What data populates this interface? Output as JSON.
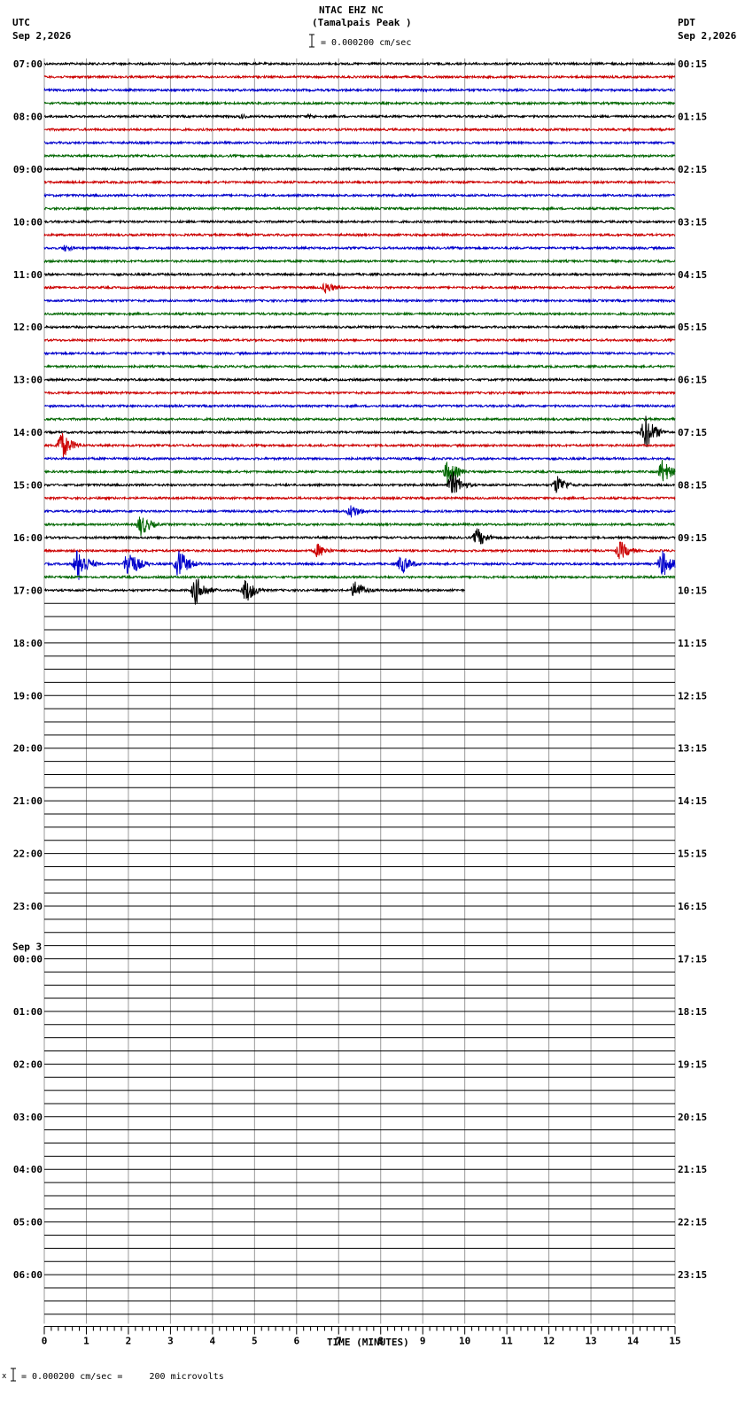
{
  "header": {
    "station": "NTAC EHZ NC",
    "site": "(Tamalpais Peak )",
    "scale_label": "= 0.000200 cm/sec",
    "left_tz": "UTC",
    "left_date": "Sep 2,2026",
    "right_tz": "PDT",
    "right_date": "Sep 2,2026"
  },
  "footer": {
    "scale_note": "= 0.000200 cm/sec =     200 microvolts",
    "corner_mark": "x"
  },
  "chart_data": {
    "type": "line",
    "title": "NTAC EHZ NC (Tamalpais Peak )",
    "xlabel": "TIME (MINUTES)",
    "xlim": [
      0,
      15
    ],
    "x_ticks": [
      "0",
      "1",
      "2",
      "3",
      "4",
      "5",
      "6",
      "7",
      "8",
      "9",
      "10",
      "11",
      "12",
      "13",
      "14",
      "15"
    ],
    "rows_per_hour": 4,
    "total_rows": 96,
    "rows_with_data": 41,
    "last_row_end_minute": 10,
    "trace_colors": [
      "#000000",
      "#cc0000",
      "#0000cc",
      "#006600"
    ],
    "utc_labels": [
      "07:00",
      "08:00",
      "09:00",
      "10:00",
      "11:00",
      "12:00",
      "13:00",
      "14:00",
      "15:00",
      "16:00",
      "17:00",
      "18:00",
      "19:00",
      "20:00",
      "21:00",
      "22:00",
      "23:00",
      "00:00",
      "01:00",
      "02:00",
      "03:00",
      "04:00",
      "05:00",
      "06:00"
    ],
    "date_change_label": "Sep 3",
    "local_labels": [
      "00:15",
      "01:15",
      "02:15",
      "03:15",
      "04:15",
      "05:15",
      "06:15",
      "07:15",
      "08:15",
      "09:15",
      "10:15",
      "11:15",
      "12:15",
      "13:15",
      "14:15",
      "15:15",
      "16:15",
      "17:15",
      "18:15",
      "19:15",
      "20:15",
      "21:15",
      "22:15",
      "23:15"
    ],
    "events": [
      {
        "row": 4,
        "minute": 4.7,
        "amp": 0.2
      },
      {
        "row": 4,
        "minute": 6.3,
        "amp": 0.2
      },
      {
        "row": 14,
        "minute": 0.5,
        "amp": 0.3
      },
      {
        "row": 17,
        "minute": 6.7,
        "amp": 0.5
      },
      {
        "row": 28,
        "minute": 14.3,
        "amp": 1.4
      },
      {
        "row": 29,
        "minute": 0.4,
        "amp": 1.2
      },
      {
        "row": 31,
        "minute": 9.6,
        "amp": 1.0
      },
      {
        "row": 31,
        "minute": 14.7,
        "amp": 1.0
      },
      {
        "row": 32,
        "minute": 9.7,
        "amp": 1.1
      },
      {
        "row": 32,
        "minute": 12.2,
        "amp": 0.8
      },
      {
        "row": 34,
        "minute": 7.3,
        "amp": 0.6
      },
      {
        "row": 35,
        "minute": 2.3,
        "amp": 0.9
      },
      {
        "row": 36,
        "minute": 10.3,
        "amp": 0.8
      },
      {
        "row": 37,
        "minute": 6.5,
        "amp": 0.6
      },
      {
        "row": 37,
        "minute": 13.7,
        "amp": 0.8
      },
      {
        "row": 38,
        "minute": 0.8,
        "amp": 1.4
      },
      {
        "row": 38,
        "minute": 2.0,
        "amp": 1.3
      },
      {
        "row": 38,
        "minute": 3.2,
        "amp": 1.2
      },
      {
        "row": 38,
        "minute": 8.5,
        "amp": 0.8
      },
      {
        "row": 38,
        "minute": 14.7,
        "amp": 1.1
      },
      {
        "row": 40,
        "minute": 3.6,
        "amp": 1.2
      },
      {
        "row": 40,
        "minute": 4.8,
        "amp": 1.0
      },
      {
        "row": 40,
        "minute": 7.4,
        "amp": 0.8
      }
    ]
  }
}
